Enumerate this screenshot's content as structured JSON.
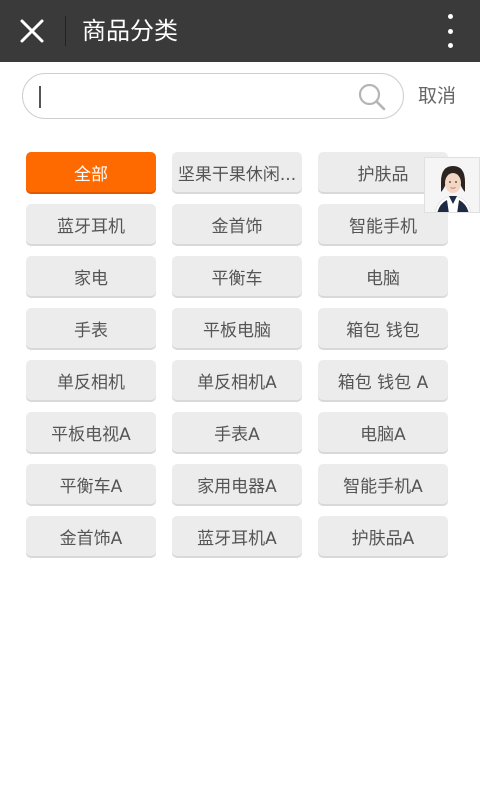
{
  "header": {
    "title": "商品分类",
    "close_icon": "close-icon",
    "more_icon": "more-vertical-icon",
    "background": "#3a3a3a"
  },
  "search": {
    "value": "",
    "placeholder": "",
    "icon": "search-icon",
    "cancel_label": "取消"
  },
  "categories": [
    {
      "label": "全部",
      "active": true
    },
    {
      "label": "坚果干果休闲...",
      "active": false
    },
    {
      "label": "护肤品",
      "active": false
    },
    {
      "label": "蓝牙耳机",
      "active": false
    },
    {
      "label": "金首饰",
      "active": false
    },
    {
      "label": "智能手机",
      "active": false
    },
    {
      "label": "家电",
      "active": false
    },
    {
      "label": "平衡车",
      "active": false
    },
    {
      "label": "电脑",
      "active": false
    },
    {
      "label": "手表",
      "active": false
    },
    {
      "label": "平板电脑",
      "active": false
    },
    {
      "label": "箱包 钱包",
      "active": false
    },
    {
      "label": "单反相机",
      "active": false
    },
    {
      "label": "单反相机A",
      "active": false
    },
    {
      "label": "箱包 钱包 A",
      "active": false
    },
    {
      "label": "平板电视A",
      "active": false
    },
    {
      "label": "手表A",
      "active": false
    },
    {
      "label": "电脑A",
      "active": false
    },
    {
      "label": "平衡车A",
      "active": false
    },
    {
      "label": "家用电器A",
      "active": false
    },
    {
      "label": "智能手机A",
      "active": false
    },
    {
      "label": "金首饰A",
      "active": false
    },
    {
      "label": "蓝牙耳机A",
      "active": false
    },
    {
      "label": "护肤品A",
      "active": false
    }
  ],
  "colors": {
    "accent": "#ff6a00",
    "chip_bg": "#ececec",
    "chip_text": "#555555"
  },
  "service": {
    "icon": "customer-service-avatar-icon"
  }
}
